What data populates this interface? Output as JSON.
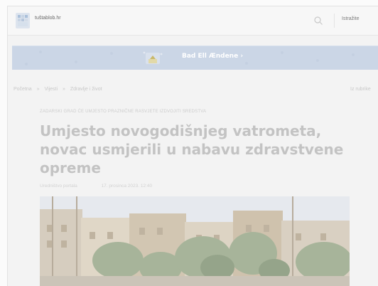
{
  "header": {
    "site_name": "tuštablob.hr",
    "user_label": "Istražite"
  },
  "banner": {
    "button_label": "Bad Ell Ændene  ›"
  },
  "breadcrumb": {
    "items": [
      "Početna",
      "»",
      "Vijesti",
      "»",
      "Zdravlje i život"
    ],
    "right_label": "Iz rubrike"
  },
  "article": {
    "tagline": "ZADARSKI GRAD ĆE UMJESTO PRAZNIČNE RASVJETE IZDVOJITI SREDSTVA",
    "headline": "Umjesto novogodišnjeg vatrometa, novac usmjerili u nabavu zdravstvene opreme",
    "author": "Uredništvo portala",
    "date": "17. prosinca 2023. 12:40",
    "photo": "harbor-street-photo"
  },
  "colors": {
    "banner": "#cbd6e6",
    "headline": "#c3c3c3",
    "background": "#f3f3f3"
  }
}
